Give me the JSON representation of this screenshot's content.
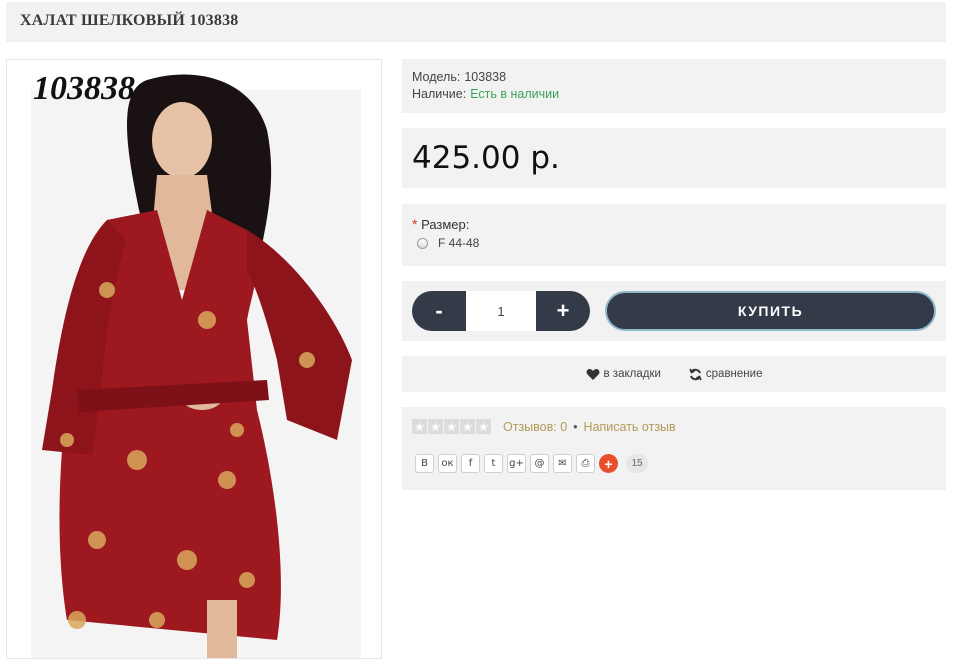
{
  "product": {
    "title": "ХАЛАТ ШЕЛКОВЫЙ 103838",
    "image_code": "103838",
    "model_label": "Модель:",
    "model_value": "103838",
    "stock_label": "Наличие:",
    "stock_value": "Есть в наличии",
    "price": "425.00 р."
  },
  "options": {
    "required_mark": "*",
    "size_label": "Размер:",
    "size_option": "F 44-48"
  },
  "cart": {
    "minus": "-",
    "quantity": "1",
    "plus": "+",
    "buy_label": "КУПИТЬ"
  },
  "actions": {
    "wishlist_label": "в закладки",
    "compare_label": "сравнение"
  },
  "reviews": {
    "rating": 0,
    "reviews_link": "Отзывов: 0",
    "separator": "•",
    "write_link": "Написать отзыв"
  },
  "share": {
    "buttons": [
      "В",
      "ок",
      "f",
      "t",
      "g+",
      "@",
      "✉",
      "⎙"
    ],
    "more": "+",
    "count": "15"
  },
  "colors": {
    "panel_bg": "#f2f2f2",
    "button_dark": "#333a48",
    "stock_green": "#3aa35b",
    "link_gold": "#b39a5a",
    "share_orange": "#e8502c"
  }
}
